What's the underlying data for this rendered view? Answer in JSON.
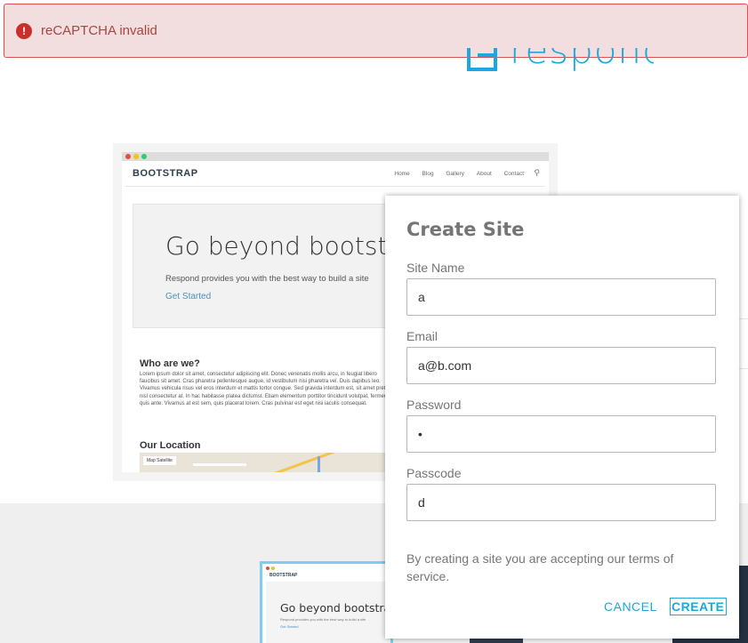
{
  "alert": {
    "icon": "exclamation-circle-icon",
    "text": "reCAPTCHA invalid",
    "color": "#a94442",
    "background": "#f2dede"
  },
  "brand": {
    "logo_text": "respond",
    "color": "#1ea7dc"
  },
  "preview": {
    "brand": "BOOTSTRAP",
    "menu": [
      "Home",
      "Blog",
      "Gallery",
      "About",
      "Contact"
    ],
    "hero_title": "Go beyond bootstrap",
    "hero_subtitle": "Respond provides you with the best way to build a site",
    "hero_link": "Get Started",
    "section_who": "Who are we?",
    "lorem": "Lorem ipsum dolor sit amet, consectetur adipiscing elit. Donec venenatis mollis arcu, in feugiat libero faucibus sit amet. Cras pharetra pellentesque augue, id vestibulum nisi pharetra vel. Duis dapibus leo. Vivamus vehicula risus vel eros interdum et mattis tortor congue. Sed gravida interdum est, sit amet pretium nisl consectetur at. In hac habitasse platea dictumst. Etiam elementum porttitor tincidunt volutpat, fermentum quis ante. Vivamus at est sem, quis placerat lorem. Cras pulvinar est eget nisi iaculis consequat.",
    "section_location": "Our Location",
    "map_button": "Map  Satellite"
  },
  "thumbnail": {
    "brand": "BOOTSTRAP",
    "hero_title": "Go beyond bootstrap",
    "hero_subtitle": "Respond provides you with the best way to build a site",
    "hero_link": "Get Started"
  },
  "dialog": {
    "title": "Create Site",
    "fields": [
      {
        "label": "Site Name",
        "value": "a"
      },
      {
        "label": "Email",
        "value": "a@b.com"
      },
      {
        "label": "Password",
        "value": "•"
      },
      {
        "label": "Passcode",
        "value": "d"
      }
    ],
    "terms": "By creating a site you are accepting our terms of service.",
    "cancel_label": "CANCEL",
    "create_label": "CREATE",
    "accent": "#1ea7dc"
  }
}
